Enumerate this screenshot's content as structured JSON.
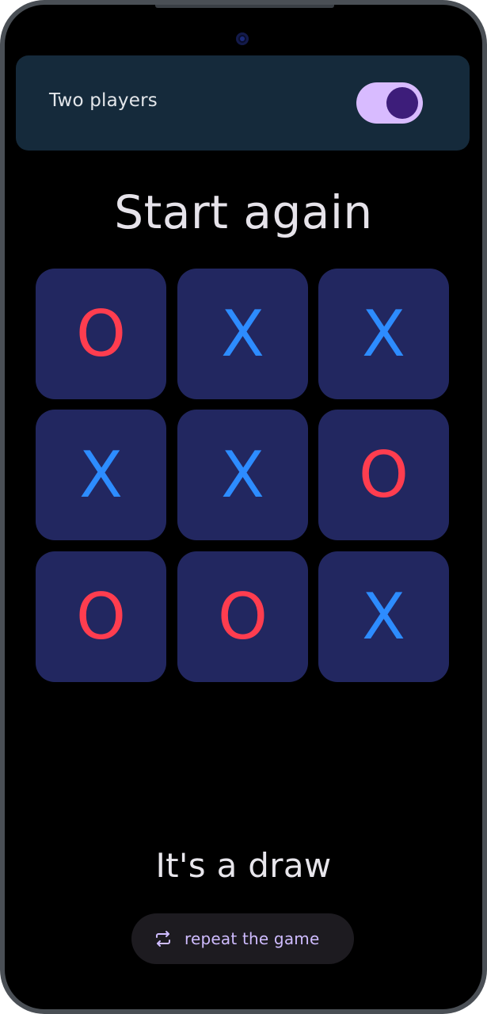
{
  "header": {
    "label": "Two players",
    "toggle_on": true
  },
  "title": "Start again",
  "board": {
    "cells": [
      "O",
      "X",
      "X",
      "X",
      "X",
      "O",
      "O",
      "O",
      "X"
    ]
  },
  "result": "It's a draw",
  "repeat_button": {
    "label": "repeat the game",
    "icon": "repeat-icon"
  },
  "colors": {
    "background": "#000000",
    "header_card": "#152a3b",
    "cell": "#222760",
    "x_mark": "#2d8cff",
    "o_mark": "#ff3d4f",
    "toggle_track": "#d8bbff",
    "toggle_knob": "#3d1d7a",
    "button_bg": "#1d1b20",
    "button_text": "#cfbcff"
  }
}
